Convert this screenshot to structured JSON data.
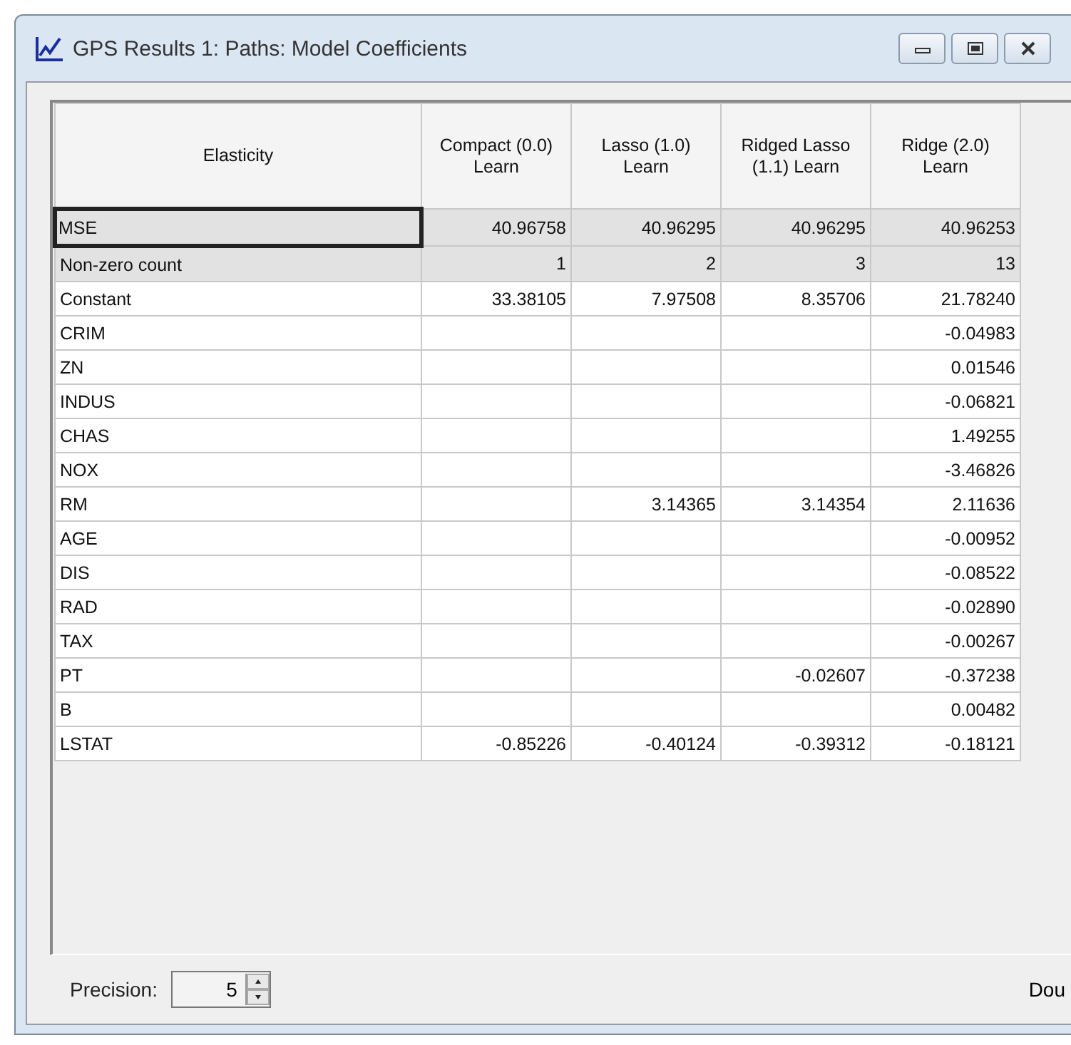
{
  "window": {
    "title": "GPS Results 1: Paths: Model Coefficients"
  },
  "table": {
    "columns": [
      "Elasticity",
      "Compact (0.0) Learn",
      "Lasso (1.0) Learn",
      "Ridged Lasso (1.1) Learn",
      "Ridge (2.0) Learn"
    ],
    "rows": [
      {
        "kind": "summary",
        "focused": true,
        "cells": [
          "MSE",
          "40.96758",
          "40.96295",
          "40.96295",
          "40.96253"
        ]
      },
      {
        "kind": "summary",
        "focused": false,
        "cells": [
          "Non-zero count",
          "1",
          "2",
          "3",
          "13"
        ]
      },
      {
        "kind": "coefficient",
        "focused": false,
        "cells": [
          "Constant",
          "33.38105",
          "7.97508",
          "8.35706",
          "21.78240"
        ]
      },
      {
        "kind": "coefficient",
        "focused": false,
        "cells": [
          "CRIM",
          "",
          "",
          "",
          "-0.04983"
        ]
      },
      {
        "kind": "coefficient",
        "focused": false,
        "cells": [
          "ZN",
          "",
          "",
          "",
          "0.01546"
        ]
      },
      {
        "kind": "coefficient",
        "focused": false,
        "cells": [
          "INDUS",
          "",
          "",
          "",
          "-0.06821"
        ]
      },
      {
        "kind": "coefficient",
        "focused": false,
        "cells": [
          "CHAS",
          "",
          "",
          "",
          "1.49255"
        ]
      },
      {
        "kind": "coefficient",
        "focused": false,
        "cells": [
          "NOX",
          "",
          "",
          "",
          "-3.46826"
        ]
      },
      {
        "kind": "coefficient",
        "focused": false,
        "cells": [
          "RM",
          "",
          "3.14365",
          "3.14354",
          "2.11636"
        ]
      },
      {
        "kind": "coefficient",
        "focused": false,
        "cells": [
          "AGE",
          "",
          "",
          "",
          "-0.00952"
        ]
      },
      {
        "kind": "coefficient",
        "focused": false,
        "cells": [
          "DIS",
          "",
          "",
          "",
          "-0.08522"
        ]
      },
      {
        "kind": "coefficient",
        "focused": false,
        "cells": [
          "RAD",
          "",
          "",
          "",
          "-0.02890"
        ]
      },
      {
        "kind": "coefficient",
        "focused": false,
        "cells": [
          "TAX",
          "",
          "",
          "",
          "-0.00267"
        ]
      },
      {
        "kind": "coefficient",
        "focused": false,
        "cells": [
          "PT",
          "",
          "",
          "-0.02607",
          "-0.37238"
        ]
      },
      {
        "kind": "coefficient",
        "focused": false,
        "cells": [
          "B",
          "",
          "",
          "",
          "0.00482"
        ]
      },
      {
        "kind": "coefficient",
        "focused": false,
        "cells": [
          "LSTAT",
          "-0.85226",
          "-0.40124",
          "-0.39312",
          "-0.18121"
        ]
      }
    ]
  },
  "footer": {
    "precision_label": "Precision:",
    "precision_value": "5",
    "cut_text": "Dou"
  }
}
